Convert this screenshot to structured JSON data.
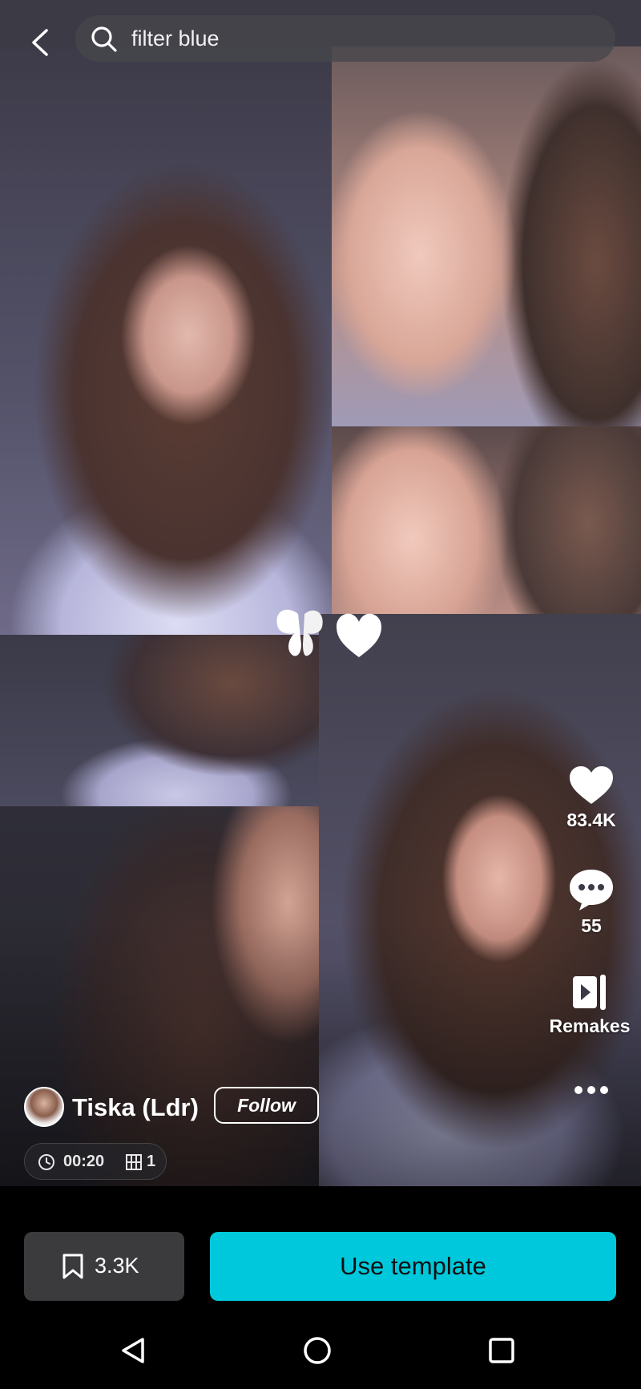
{
  "search": {
    "query": "filter blue"
  },
  "actions": {
    "likes": "83.4K",
    "comments": "55",
    "remakes_label": "Remakes"
  },
  "author": {
    "name": "Tiska (Ldr)",
    "follow_label": "Follow"
  },
  "template_meta": {
    "duration": "00:20",
    "clips": "1"
  },
  "bottom": {
    "saves": "3.3K",
    "use_label": "Use template"
  },
  "colors": {
    "accent": "#00c8dc",
    "background": "#000000",
    "save_button": "#3b3b3d"
  },
  "icons": [
    "back-arrow-icon",
    "search-icon",
    "heart-icon",
    "comment-icon",
    "remake-icon",
    "more-icon",
    "clock-icon",
    "clips-icon",
    "bookmark-icon",
    "nav-back-icon",
    "nav-home-icon",
    "nav-recents-icon"
  ]
}
